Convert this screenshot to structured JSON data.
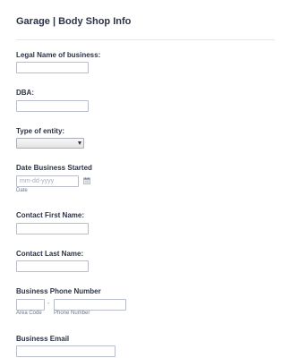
{
  "form": {
    "title": "Garage | Body Shop Info"
  },
  "fields": {
    "legal_name": {
      "label": "Legal Name of business:",
      "value": ""
    },
    "dba": {
      "label": "DBA:",
      "value": ""
    },
    "entity_type": {
      "label": "Type of entity:",
      "selected": ""
    },
    "date_started": {
      "label": "Date Business Started",
      "placeholder": "mm-dd-yyyy",
      "sublabel": "Date"
    },
    "first_name": {
      "label": "Contact First Name:",
      "value": ""
    },
    "last_name": {
      "label": "Contact Last Name:",
      "value": ""
    },
    "phone": {
      "label": "Business Phone Number",
      "area_code_sublabel": "Area Code",
      "separator": "-",
      "number_sublabel": "Phone Number"
    },
    "email": {
      "label": "Business Email",
      "value": ""
    }
  },
  "icons": {
    "date_picker": "calendar-icon"
  }
}
